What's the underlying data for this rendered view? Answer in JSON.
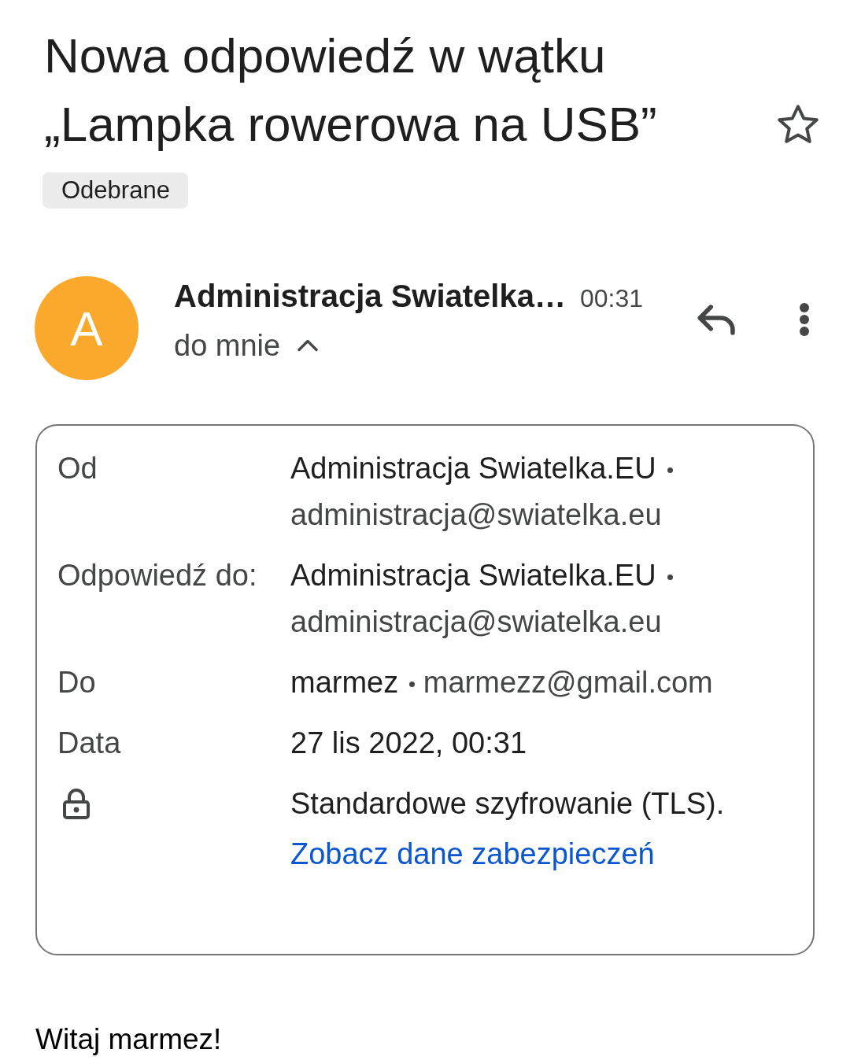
{
  "subject": {
    "title": "Nowa odpowiedź w wątku „Lampka rowerowa na USB”",
    "starred": false
  },
  "labels": [
    "Odebrane"
  ],
  "message": {
    "avatar_letter": "A",
    "sender": "Administracja Swiatelka…",
    "time": "00:31",
    "recipient": "do mnie",
    "expanded": true
  },
  "details": [
    {
      "kind": "contact",
      "label": "Od",
      "name": "Administracja Swiatelka.EU",
      "email": "administracja@swiatelka.eu"
    },
    {
      "kind": "contact",
      "label": "Odpowiedź do:",
      "name": "Administracja Swiatelka.EU",
      "email": "administracja@swiatelka.eu"
    },
    {
      "kind": "contact",
      "label": "Do",
      "name": "marmez",
      "email": "marmezz@gmail.com"
    },
    {
      "kind": "text",
      "label": "Data",
      "value": "27 lis 2022, 00:31"
    },
    {
      "kind": "security",
      "value": "Standardowe szyfrowanie (TLS).",
      "link": "Zobacz dane zabezpieczeń"
    }
  ],
  "body": {
    "greeting": "Witaj marmez!"
  }
}
